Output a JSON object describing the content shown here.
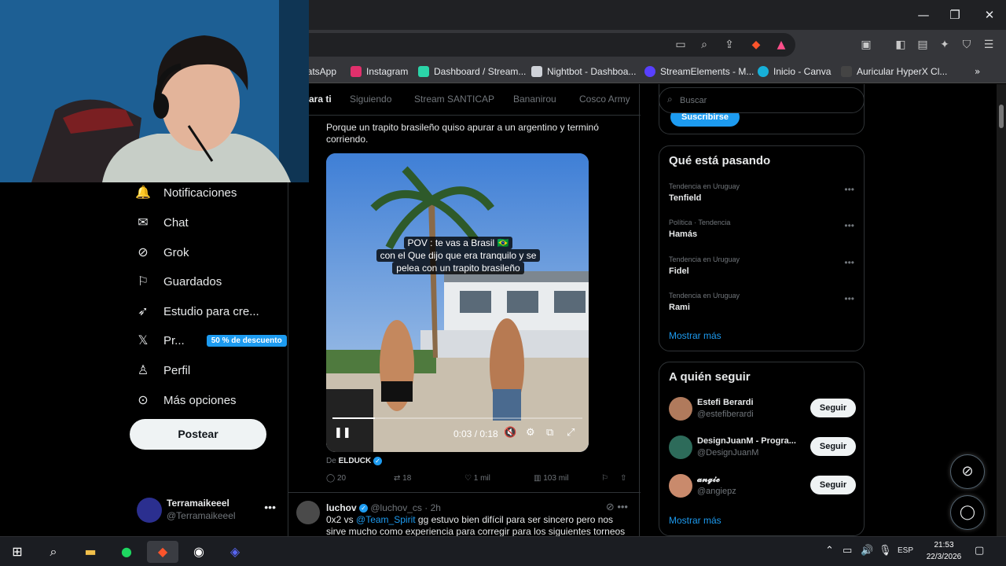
{
  "window": {
    "min": "—",
    "restore": "❐",
    "close": "✕"
  },
  "bookmarks": [
    {
      "label": "natsApp",
      "color": "#25d366"
    },
    {
      "label": "Instagram",
      "color": "#e1306c"
    },
    {
      "label": "Dashboard / Stream...",
      "color": "#2bd4a8"
    },
    {
      "label": "Nightbot - Dashboa...",
      "color": "#cfd2d8"
    },
    {
      "label": "StreamElements - M...",
      "color": "#5840ff"
    },
    {
      "label": "Inicio - Canva",
      "color": "#17b0d9"
    },
    {
      "label": "Auricular HyperX Cl...",
      "color": "#444444"
    }
  ],
  "tabs": [
    "ara ti",
    "Siguiendo",
    "Stream SANTICAP",
    "Bananirou",
    "Cosco Army"
  ],
  "nav": [
    {
      "label": "Notificaciones",
      "icon": "🔔"
    },
    {
      "label": "Chat",
      "icon": "✉"
    },
    {
      "label": "Grok",
      "icon": "⊘"
    },
    {
      "label": "Guardados",
      "icon": "⚐"
    },
    {
      "label": "Estudio para cre...",
      "icon": "🚀"
    },
    {
      "label": "Pr...",
      "icon": "𝕏",
      "badge": "50 % de descuento"
    },
    {
      "label": "Perfil",
      "icon": "👤"
    },
    {
      "label": "Más opciones",
      "icon": "⋯"
    }
  ],
  "post_button": "Postear",
  "account": {
    "name": "Terramaikeeel",
    "handle": "@Terramaikeeel"
  },
  "post": {
    "text": "Porque un trapito brasileño quiso apurar a un argentino y terminó corriendo.",
    "caption_1": "POV : te vas a Brasil 🇧🇷",
    "caption_2": "con el Que dijo que era tranquilo y se",
    "caption_3": "pelea con un trapito brasileño",
    "time": "0:03 / 0:18",
    "progress": 0.17,
    "from_prefix": "De",
    "from_name": "ELDUCK",
    "replies": "20",
    "reposts": "18",
    "likes": "1 mil",
    "views": "103 mil"
  },
  "reply": {
    "name": "luchov",
    "handle": "@luchov_cs · 2h",
    "text_1": "0x2 vs",
    "mention": "@Team_Spirit",
    "text_2": "gg estuvo bien difícil para ser sincero pero nos sirve mucho como experiencia para corregir para los siguientes torneos tier s"
  },
  "search_placeholder": "Buscar",
  "subscribe": "Suscribirse",
  "trending": {
    "title": "Qué está pasando",
    "items": [
      {
        "meta": "Tendencia en Uruguay",
        "name": "Tenfield"
      },
      {
        "meta": "Política · Tendencia",
        "name": "Hamás"
      },
      {
        "meta": "Tendencia en Uruguay",
        "name": "Fidel"
      },
      {
        "meta": "Tendencia en Uruguay",
        "name": "Rami"
      }
    ],
    "show_more": "Mostrar más"
  },
  "who_to_follow": {
    "title": "A quién seguir",
    "items": [
      {
        "name": "Estefi Berardi",
        "handle": "@estefiberardi",
        "button": "Seguir",
        "color": "#b07a5c"
      },
      {
        "name": "DesignJuanM - Progra...",
        "handle": "@DesignJuanM",
        "button": "Seguir",
        "color": "#2d6b5a"
      },
      {
        "name": "𝓪𝓷𝓰𝓲𝓮",
        "handle": "@angiepz",
        "button": "Seguir",
        "color": "#c98a6c"
      }
    ],
    "show_more": "Mostrar más"
  },
  "taskbar": {
    "lang": "ESP",
    "time": "21:53",
    "date": "22/3/2026"
  }
}
